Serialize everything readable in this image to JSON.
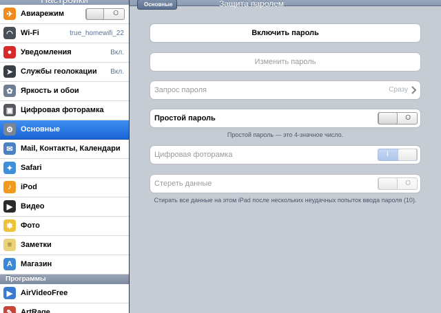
{
  "sidebar": {
    "title": "Настройки",
    "items": [
      {
        "label": "Авиарежим",
        "value": "",
        "toggle": "O",
        "icon": "airplane-icon",
        "color": "#f08a1c",
        "glyph": "✈"
      },
      {
        "label": "Wi-Fi",
        "value": "true_homewifi_22",
        "icon": "wifi-icon",
        "color": "#4a4f58",
        "glyph": "◠"
      },
      {
        "label": "Уведомления",
        "value": "Вкл.",
        "icon": "notifications-icon",
        "color": "#d72b2b",
        "glyph": "●"
      },
      {
        "label": "Службы геолокации",
        "value": "Вкл.",
        "icon": "location-icon",
        "color": "#3a3f47",
        "glyph": "➤"
      },
      {
        "label": "Яркость и обои",
        "value": "",
        "icon": "brightness-icon",
        "color": "#6e7f94",
        "glyph": "✿"
      },
      {
        "label": "Цифровая фоторамка",
        "value": "",
        "icon": "picture-frame-icon",
        "color": "#55585d",
        "glyph": "▣"
      },
      {
        "label": "Основные",
        "value": "",
        "icon": "gear-icon",
        "color": "#7a8595",
        "glyph": "⚙",
        "selected": true
      },
      {
        "label": "Mail, Контакты, Календари",
        "value": "",
        "icon": "mail-icon",
        "color": "#4b82c6",
        "glyph": "✉"
      },
      {
        "label": "Safari",
        "value": "",
        "icon": "safari-icon",
        "color": "#3f8fdb",
        "glyph": "✦"
      },
      {
        "label": "iPod",
        "value": "",
        "icon": "ipod-icon",
        "color": "#f29a1f",
        "glyph": "♪"
      },
      {
        "label": "Видео",
        "value": "",
        "icon": "video-icon",
        "color": "#2a2a2a",
        "glyph": "▶"
      },
      {
        "label": "Фото",
        "value": "",
        "icon": "photos-icon",
        "color": "#f0c23a",
        "glyph": "✽"
      },
      {
        "label": "Заметки",
        "value": "",
        "icon": "notes-icon",
        "color": "#e9d27a",
        "glyph": "≡"
      }
    ],
    "store": {
      "label": "Магазин",
      "icon": "store-icon",
      "color": "#3d88d6",
      "glyph": "A"
    },
    "section_header": "Программы",
    "apps": [
      {
        "label": "AirVideoFree",
        "icon": "airvideo-icon",
        "color": "#3b7bd0",
        "glyph": "▶"
      },
      {
        "label": "ArtRage",
        "icon": "artrage-icon",
        "color": "#c6473a",
        "glyph": "✎"
      }
    ]
  },
  "nav": {
    "back_label": "Основные",
    "title": "Защита паролем"
  },
  "main": {
    "enable_password": "Включить пароль",
    "change_password": "Изменить пароль",
    "require_password": {
      "label": "Запрос пароля",
      "value": "Сразу"
    },
    "simple_password": {
      "label": "Простой пароль",
      "toggle": "O"
    },
    "simple_note": "Простой пароль — это 4-значное число.",
    "picture_frame": {
      "label": "Цифровая фоторамка",
      "toggle": "I"
    },
    "erase_data": {
      "label": "Стереть данные",
      "toggle": "O"
    },
    "erase_note": "Стирать все данные на этом iPad после нескольких неудачных попыток ввода пароля (10)."
  },
  "colors": {
    "accent": "#1a63d6",
    "background": "#c5ccd4"
  }
}
